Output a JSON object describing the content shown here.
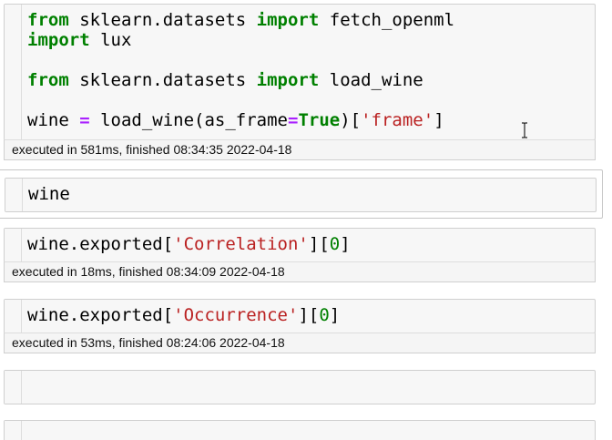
{
  "cells": [
    {
      "id": "cell1",
      "code_lines": [
        [
          {
            "t": "from",
            "c": "kw"
          },
          {
            "t": " sklearn.datasets ",
            "c": ""
          },
          {
            "t": "import",
            "c": "kw"
          },
          {
            "t": " fetch_openml",
            "c": ""
          }
        ],
        [
          {
            "t": "import",
            "c": "kw"
          },
          {
            "t": " lux",
            "c": ""
          }
        ],
        [],
        [
          {
            "t": "from",
            "c": "kw"
          },
          {
            "t": " sklearn.datasets ",
            "c": ""
          },
          {
            "t": "import",
            "c": "kw"
          },
          {
            "t": " load_wine",
            "c": ""
          }
        ],
        [],
        [
          {
            "t": "wine ",
            "c": ""
          },
          {
            "t": "=",
            "c": "op"
          },
          {
            "t": " load_wine(as_frame",
            "c": ""
          },
          {
            "t": "=",
            "c": "op"
          },
          {
            "t": "True",
            "c": "bool"
          },
          {
            "t": ")[",
            "c": ""
          },
          {
            "t": "'frame'",
            "c": "str"
          },
          {
            "t": "]",
            "c": ""
          }
        ]
      ],
      "exec_info": "executed in 581ms, finished 08:34:35 2022-04-18"
    },
    {
      "id": "cell2",
      "code_lines": [
        [
          {
            "t": "wine",
            "c": ""
          }
        ]
      ],
      "exec_info": ""
    },
    {
      "id": "cell3",
      "code_lines": [
        [
          {
            "t": "wine.exported[",
            "c": ""
          },
          {
            "t": "'Correlation'",
            "c": "str"
          },
          {
            "t": "][",
            "c": ""
          },
          {
            "t": "0",
            "c": "num"
          },
          {
            "t": "]",
            "c": ""
          }
        ]
      ],
      "exec_info": "executed in 18ms, finished 08:34:09 2022-04-18"
    },
    {
      "id": "cell4",
      "code_lines": [
        [
          {
            "t": "wine.exported[",
            "c": ""
          },
          {
            "t": "'Occurrence'",
            "c": "str"
          },
          {
            "t": "][",
            "c": ""
          },
          {
            "t": "0",
            "c": "num"
          },
          {
            "t": "]",
            "c": ""
          }
        ]
      ],
      "exec_info": "executed in 53ms, finished 08:24:06 2022-04-18"
    },
    {
      "id": "cell5",
      "code_lines": [],
      "exec_info": ""
    },
    {
      "id": "cell6",
      "code_lines": [],
      "exec_info": ""
    }
  ],
  "colors": {
    "keyword": "#008000",
    "operator": "#aa22ff",
    "string": "#ba2121",
    "number": "#008000",
    "cell_background": "#f7f7f7",
    "cell_border": "#cfcfcf"
  },
  "icons": {
    "mouse_cursor": "text-ibeam-cursor-icon"
  }
}
